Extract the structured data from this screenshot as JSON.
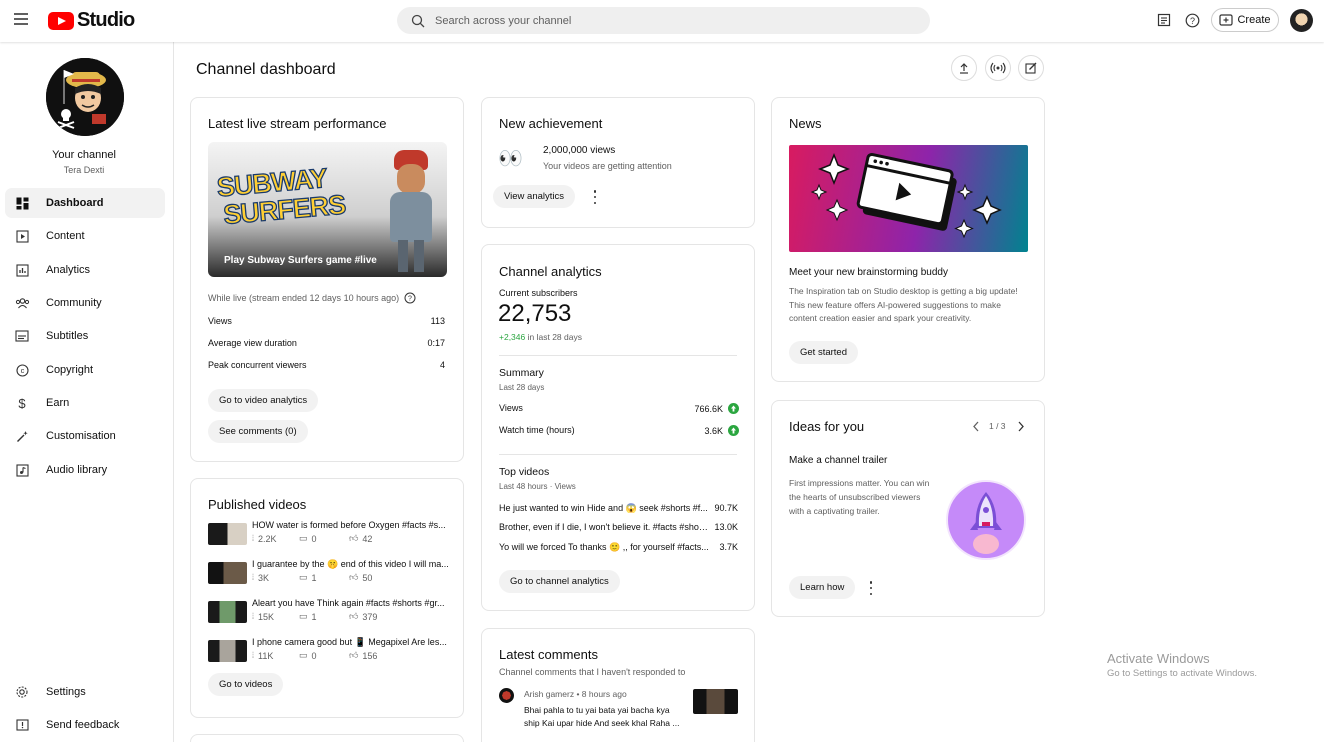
{
  "header": {
    "logo_text": "Studio",
    "search_placeholder": "Search across your channel",
    "create_label": "Create"
  },
  "sidebar": {
    "channel_title": "Your channel",
    "channel_name": "Tera Dexti",
    "items": [
      {
        "label": "Dashboard",
        "icon": "dashboard-icon"
      },
      {
        "label": "Content",
        "icon": "content-icon"
      },
      {
        "label": "Analytics",
        "icon": "analytics-icon"
      },
      {
        "label": "Community",
        "icon": "community-icon"
      },
      {
        "label": "Subtitles",
        "icon": "subtitles-icon"
      },
      {
        "label": "Copyright",
        "icon": "copyright-icon"
      },
      {
        "label": "Earn",
        "icon": "earn-icon"
      },
      {
        "label": "Customisation",
        "icon": "customisation-icon"
      },
      {
        "label": "Audio library",
        "icon": "audio-library-icon"
      }
    ],
    "bottom": [
      {
        "label": "Settings",
        "icon": "gear-icon"
      },
      {
        "label": "Send feedback",
        "icon": "feedback-icon"
      }
    ]
  },
  "main": {
    "title": "Channel dashboard",
    "live": {
      "title": "Latest live stream performance",
      "thumb_text": "Play Subway Surfers game #live",
      "thumb_logo_line1": "SUBWAY",
      "thumb_logo_line2": "SURFERS",
      "status": "While live (stream ended 12 days 10 hours ago)",
      "stats": [
        {
          "label": "Views",
          "value": "113"
        },
        {
          "label": "Average view duration",
          "value": "0:17"
        },
        {
          "label": "Peak concurrent viewers",
          "value": "4"
        }
      ],
      "btn_analytics": "Go to video analytics",
      "btn_comments": "See comments (0)"
    },
    "published": {
      "title": "Published videos",
      "videos": [
        {
          "title": "HOW water is formed before Oxygen #facts #s...",
          "views": "2.2K",
          "comments": "0",
          "likes": "42"
        },
        {
          "title": "I guarantee by the 🤫 end of this video I will ma...",
          "views": "3K",
          "comments": "1",
          "likes": "50"
        },
        {
          "title": "Aleart you have Think again #facts #shorts #gr...",
          "views": "15K",
          "comments": "1",
          "likes": "379"
        },
        {
          "title": "I phone camera good but 📱 Megapixel Are les...",
          "views": "11K",
          "comments": "0",
          "likes": "156"
        }
      ],
      "btn": "Go to videos"
    },
    "achievement": {
      "title": "New achievement",
      "emoji": "👀",
      "headline": "2,000,000 views",
      "sub": "Your videos are getting attention",
      "btn": "View analytics"
    },
    "analytics": {
      "title": "Channel analytics",
      "subs_label": "Current subscribers",
      "subs_value": "22,753",
      "subs_change": "+2,346",
      "subs_change_suffix": "in last 28 days",
      "summary_title": "Summary",
      "summary_period": "Last 28 days",
      "summary": [
        {
          "label": "Views",
          "value": "766.6K"
        },
        {
          "label": "Watch time (hours)",
          "value": "3.6K"
        }
      ],
      "top_title": "Top videos",
      "top_period": "Last 48 hours · Views",
      "top_videos": [
        {
          "title": "He just wanted to win Hide and 😱 seek #shorts #f...",
          "value": "90.7K"
        },
        {
          "title": "Brother, even if I die, I won't believe it. #facts #shorts ...",
          "value": "13.0K"
        },
        {
          "title": "Yo will we forced To thanks 🙂 ,, for yourself #facts...",
          "value": "3.7K"
        }
      ],
      "btn": "Go to channel analytics"
    },
    "comments": {
      "title": "Latest comments",
      "sub": "Channel comments that I haven't responded to",
      "author": "Arish gamerz",
      "time": "8 hours ago",
      "text": "Bhai pahla to tu yai bata yai bacha kya ship Kai upar hide And seek khal Raha ..."
    },
    "news": {
      "title": "News",
      "headline": "Meet your new brainstorming buddy",
      "body": "The Inspiration tab on Studio desktop is getting a big update! This new feature offers AI-powered suggestions to make content creation easier and spark your creativity.",
      "btn": "Get started"
    },
    "ideas": {
      "title": "Ideas for you",
      "pager": "1 / 3",
      "headline": "Make a channel trailer",
      "body": "First impressions matter. You can win the hearts of unsubscribed viewers with a captivating trailer.",
      "btn": "Learn how"
    }
  },
  "watermark": {
    "line1": "Activate Windows",
    "line2": "Go to Settings to activate Windows."
  },
  "colors": {
    "brand_red": "#ff0000",
    "positive_green": "#2ba640",
    "news_gradient": [
      "#c2185b",
      "#7b1fa2",
      "#00838f"
    ],
    "ideas_purple": "#c58af9"
  }
}
